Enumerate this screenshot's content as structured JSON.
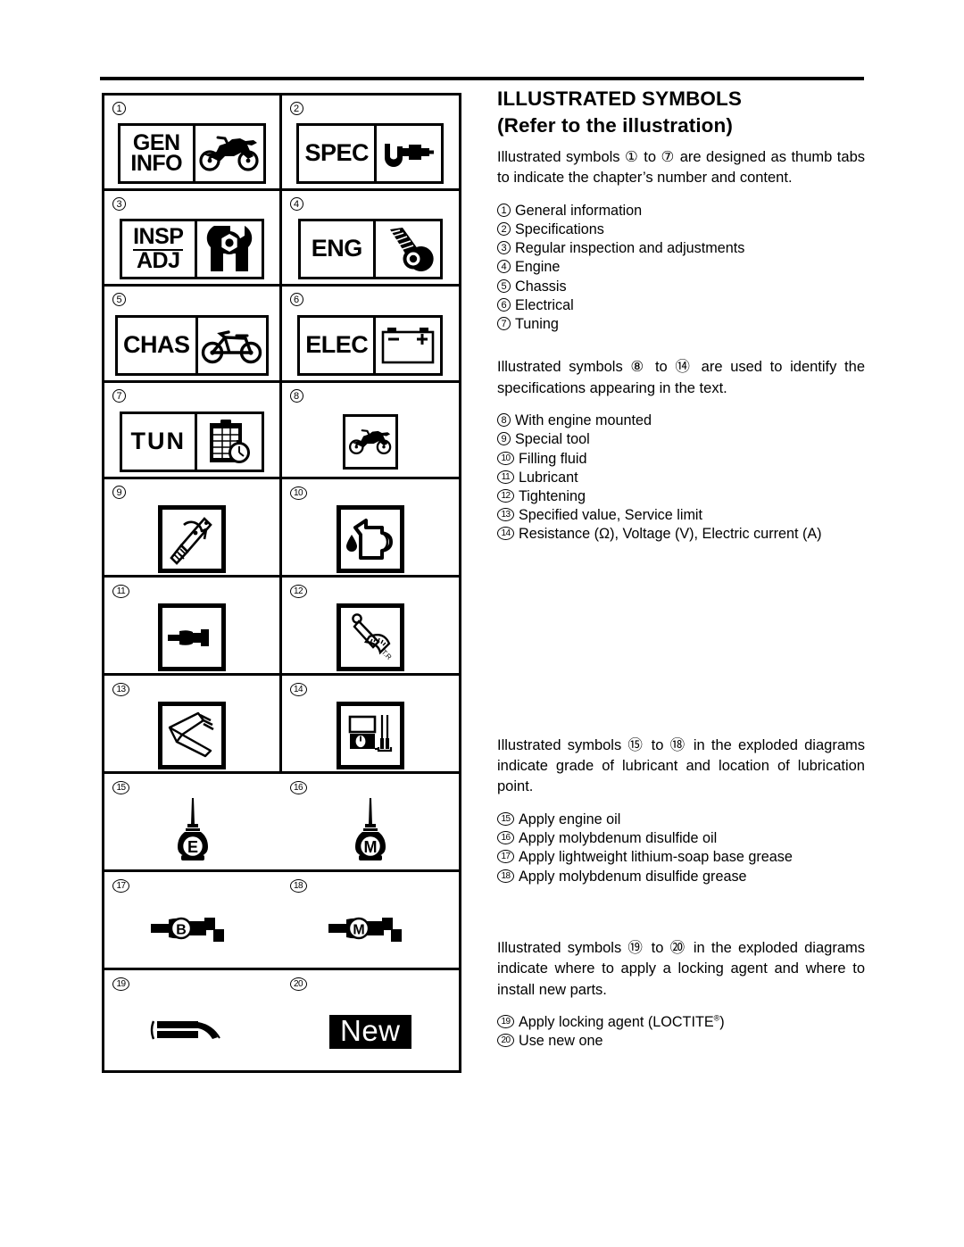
{
  "header": {
    "title": "ILLUSTRATED SYMBOLS",
    "subtitle": "(Refer to the illustration)"
  },
  "sections": [
    {
      "id": "chapter-tabs",
      "paragraph": "Illustrated symbols ① to ⑦ are designed as thumb tabs to indicate the chapter’s number and content.",
      "items": [
        {
          "num": "1",
          "label": "General information"
        },
        {
          "num": "2",
          "label": "Specifications"
        },
        {
          "num": "3",
          "label": "Regular inspection and adjustments"
        },
        {
          "num": "4",
          "label": "Engine"
        },
        {
          "num": "5",
          "label": "Chassis"
        },
        {
          "num": "6",
          "label": "Electrical"
        },
        {
          "num": "7",
          "label": "Tuning"
        }
      ]
    },
    {
      "id": "specification-symbols",
      "paragraph": "Illustrated symbols ⑧ to ⑭ are used to identify the specifications appearing in the text.",
      "items": [
        {
          "num": "8",
          "label": "With engine mounted"
        },
        {
          "num": "9",
          "label": "Special tool"
        },
        {
          "num": "10",
          "label": "Filling fluid"
        },
        {
          "num": "11",
          "label": "Lubricant"
        },
        {
          "num": "12",
          "label": "Tightening"
        },
        {
          "num": "13",
          "label": "Specified value, Service limit"
        },
        {
          "num": "14",
          "label": "Resistance (Ω), Voltage (V), Electric current (A)"
        }
      ]
    },
    {
      "id": "lubricant-symbols",
      "paragraph": "Illustrated symbols ⑮ to ⑱ in the exploded diagrams indicate grade of lubricant and location of lubrication point.",
      "items": [
        {
          "num": "15",
          "label": "Apply engine oil"
        },
        {
          "num": "16",
          "label": "Apply molybdenum disulfide oil"
        },
        {
          "num": "17",
          "label": "Apply lightweight lithium-soap base grease"
        },
        {
          "num": "18",
          "label": "Apply molybdenum disulfide grease"
        }
      ]
    },
    {
      "id": "locking-agent-symbols",
      "paragraph": "Illustrated symbols ⑲ to ⑳ in the exploded diagrams indicate where to apply a locking agent and where to install new parts.",
      "items": [
        {
          "num": "19",
          "label": "Apply locking agent (LOCTITE",
          "sup": "®",
          "label_tail": ")"
        },
        {
          "num": "20",
          "label": "Use new one"
        }
      ]
    }
  ],
  "symbol_table": {
    "cells": [
      {
        "num": "1",
        "kind": "tab",
        "text": [
          "GEN",
          "INFO"
        ],
        "icon": "dirt-bike-icon"
      },
      {
        "num": "2",
        "kind": "tab",
        "text": [
          "SPEC"
        ],
        "icon": "micrometer-icon"
      },
      {
        "num": "3",
        "kind": "tab",
        "text": [
          "INSP",
          "ADJ"
        ],
        "icon": "wrench-nut-icon"
      },
      {
        "num": "4",
        "kind": "tab",
        "text": [
          "ENG"
        ],
        "icon": "piston-icon"
      },
      {
        "num": "5",
        "kind": "tab",
        "text": [
          "CHAS"
        ],
        "icon": "bike-frame-icon"
      },
      {
        "num": "6",
        "kind": "tab",
        "text": [
          "ELEC"
        ],
        "icon": "battery-icon"
      },
      {
        "num": "7",
        "kind": "tab",
        "text": [
          "TUN"
        ],
        "icon": "clipboard-stopwatch-icon"
      },
      {
        "num": "8",
        "kind": "frame",
        "icon": "engine-mounted-bike-icon"
      },
      {
        "num": "9",
        "kind": "frame",
        "icon": "special-tool-icon"
      },
      {
        "num": "10",
        "kind": "frame",
        "icon": "oil-can-pour-icon"
      },
      {
        "num": "11",
        "kind": "frame",
        "icon": "lubricant-tube-icon"
      },
      {
        "num": "12",
        "kind": "frame",
        "icon": "torque-wrench-icon"
      },
      {
        "num": "13",
        "kind": "frame",
        "icon": "caliper-measure-icon"
      },
      {
        "num": "14",
        "kind": "frame",
        "icon": "multimeter-icon"
      },
      {
        "num": "15",
        "kind": "plain",
        "icon": "oil-bottle-icon",
        "letter": "E"
      },
      {
        "num": "16",
        "kind": "plain",
        "icon": "oil-bottle-icon",
        "letter": "M"
      },
      {
        "num": "17",
        "kind": "plain",
        "icon": "grease-gun-icon",
        "letter": "B"
      },
      {
        "num": "18",
        "kind": "plain",
        "icon": "grease-gun-icon",
        "letter": "M"
      },
      {
        "num": "19",
        "kind": "plain",
        "icon": "locking-agent-icon"
      },
      {
        "num": "20",
        "kind": "plain",
        "icon": "new-part-badge",
        "badge": "New"
      }
    ]
  },
  "colors": {
    "ink": "#000000",
    "paper": "#ffffff"
  }
}
